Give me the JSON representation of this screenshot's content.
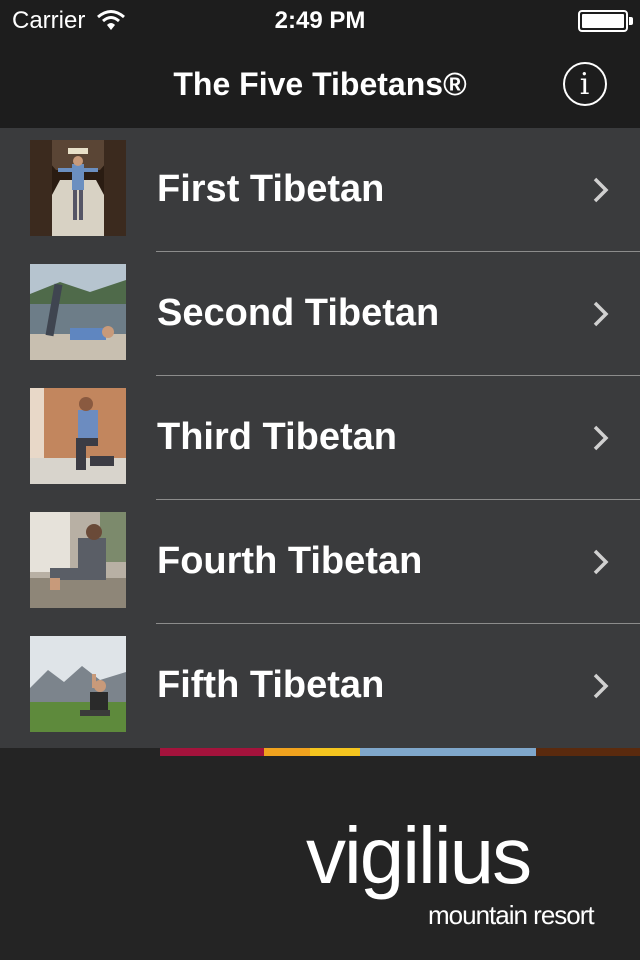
{
  "status_bar": {
    "carrier": "Carrier",
    "time": "2:49 PM",
    "wifi_icon": "wifi-icon",
    "battery_icon": "battery-icon",
    "battery_level": 1.0
  },
  "nav": {
    "title": "The Five Tibetans®",
    "info_icon": "info-circle-icon",
    "info_glyph": "i"
  },
  "list": {
    "items": [
      {
        "label": "First Tibetan",
        "thumbnail": "first-tibetan-thumbnail",
        "chevron": "chevron-right-icon"
      },
      {
        "label": "Second Tibetan",
        "thumbnail": "second-tibetan-thumbnail",
        "chevron": "chevron-right-icon"
      },
      {
        "label": "Third Tibetan",
        "thumbnail": "third-tibetan-thumbnail",
        "chevron": "chevron-right-icon"
      },
      {
        "label": "Fourth Tibetan",
        "thumbnail": "fourth-tibetan-thumbnail",
        "chevron": "chevron-right-icon"
      },
      {
        "label": "Fifth Tibetan",
        "thumbnail": "fifth-tibetan-thumbnail",
        "chevron": "chevron-right-icon"
      }
    ]
  },
  "stripe_colors": [
    "#a4133c",
    "#f0a21e",
    "#f4c51f",
    "#7fa7cb",
    "#5a2a0e"
  ],
  "footer": {
    "logo_main": "vigilius",
    "logo_sub": "mountain resort"
  },
  "colors": {
    "nav_background": "#1d1d1d",
    "list_background": "#3a3b3d",
    "footer_background": "#242424",
    "text": "#ffffff"
  }
}
